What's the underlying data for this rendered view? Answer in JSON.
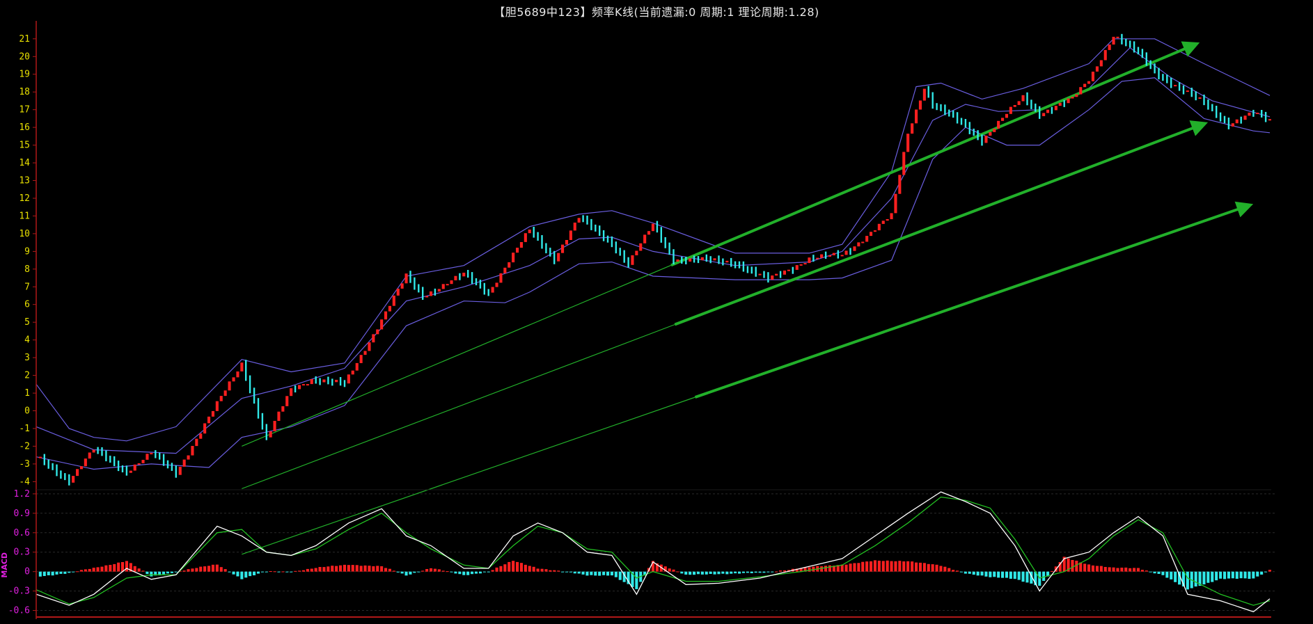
{
  "title": "【胆5689中123】频率K线(当前遗漏:0 周期:1 理论周期:1.28)",
  "colors": {
    "background": "#000000",
    "up_candle": "#ff2020",
    "down_candle": "#30e8e8",
    "band": "#6a5ee0",
    "trend": "#22b02a",
    "axis": "#b01818",
    "price_ticks": "#e8e000",
    "macd_ticks": "#e020e0",
    "dif": "#ffffff",
    "dea": "#22c022"
  },
  "chart_data": [
    {
      "type": "candlestick",
      "name": "price-panel",
      "ylim": [
        -4.3,
        21.7
      ],
      "yticks": [
        -4,
        -3,
        -2,
        -1,
        0,
        1,
        2,
        3,
        4,
        5,
        6,
        7,
        8,
        9,
        10,
        11,
        12,
        13,
        14,
        15,
        16,
        17,
        18,
        19,
        20,
        21
      ],
      "ytick_labels": [
        "-4",
        "-3",
        "-2",
        "-1",
        "0",
        "1",
        "2",
        "3",
        "4",
        "5",
        "6",
        "7",
        "8",
        "9",
        "10",
        "11",
        "12",
        "13",
        "14",
        "15",
        "16",
        "17",
        "18",
        "19",
        "20",
        "21"
      ],
      "count": 240,
      "path": [
        [
          0,
          -2.6
        ],
        [
          8,
          -3.9
        ],
        [
          14,
          -2.2
        ],
        [
          22,
          -3.4
        ],
        [
          28,
          -2.4
        ],
        [
          34,
          -3.5
        ],
        [
          50,
          2.7
        ],
        [
          56,
          -1.6
        ],
        [
          62,
          1.2
        ],
        [
          67,
          1.8
        ],
        [
          75,
          1.5
        ],
        [
          90,
          7.6
        ],
        [
          94,
          6.5
        ],
        [
          104,
          7.7
        ],
        [
          110,
          6.7
        ],
        [
          120,
          10.2
        ],
        [
          126,
          8.6
        ],
        [
          132,
          10.9
        ],
        [
          140,
          9.5
        ],
        [
          144,
          8.3
        ],
        [
          150,
          10.5
        ],
        [
          155,
          8.6
        ],
        [
          170,
          8.4
        ],
        [
          178,
          7.4
        ],
        [
          188,
          8.6
        ],
        [
          196,
          8.8
        ],
        [
          208,
          11.0
        ],
        [
          212,
          15.7
        ],
        [
          216,
          18.3
        ],
        [
          218,
          17.3
        ],
        [
          226,
          16.1
        ],
        [
          230,
          15.3
        ],
        [
          240,
          17.7
        ],
        [
          244,
          16.8
        ],
        [
          252,
          17.6
        ],
        [
          256,
          18.7
        ],
        [
          262,
          21.2
        ],
        [
          268,
          20.2
        ],
        [
          272,
          19.2
        ],
        [
          278,
          18.2
        ],
        [
          284,
          17.4
        ],
        [
          290,
          16.2
        ],
        [
          296,
          16.8
        ],
        [
          300,
          16.4
        ]
      ],
      "bands": {
        "upper": [
          [
            0,
            1.5
          ],
          [
            8,
            -1.0
          ],
          [
            14,
            -1.5
          ],
          [
            22,
            -1.7
          ],
          [
            34,
            -0.9
          ],
          [
            50,
            2.9
          ],
          [
            62,
            2.2
          ],
          [
            75,
            2.7
          ],
          [
            90,
            7.6
          ],
          [
            104,
            8.2
          ],
          [
            120,
            10.4
          ],
          [
            132,
            11.1
          ],
          [
            140,
            11.3
          ],
          [
            150,
            10.6
          ],
          [
            170,
            8.9
          ],
          [
            188,
            8.9
          ],
          [
            196,
            9.4
          ],
          [
            208,
            13.5
          ],
          [
            214,
            18.3
          ],
          [
            220,
            18.5
          ],
          [
            230,
            17.6
          ],
          [
            240,
            18.2
          ],
          [
            256,
            19.6
          ],
          [
            262,
            21.0
          ],
          [
            272,
            21.0
          ],
          [
            284,
            19.6
          ],
          [
            300,
            17.8
          ]
        ],
        "middle": [
          [
            0,
            -0.9
          ],
          [
            14,
            -2.2
          ],
          [
            34,
            -2.4
          ],
          [
            50,
            0.7
          ],
          [
            62,
            1.4
          ],
          [
            75,
            2.4
          ],
          [
            90,
            6.2
          ],
          [
            104,
            7.0
          ],
          [
            120,
            8.2
          ],
          [
            132,
            9.7
          ],
          [
            140,
            9.8
          ],
          [
            150,
            9.0
          ],
          [
            170,
            8.2
          ],
          [
            188,
            8.4
          ],
          [
            196,
            9.0
          ],
          [
            208,
            12.0
          ],
          [
            218,
            16.4
          ],
          [
            226,
            17.3
          ],
          [
            234,
            16.9
          ],
          [
            244,
            17.0
          ],
          [
            256,
            18.2
          ],
          [
            266,
            20.5
          ],
          [
            276,
            18.8
          ],
          [
            286,
            17.5
          ],
          [
            300,
            16.6
          ]
        ],
        "lower": [
          [
            0,
            -2.6
          ],
          [
            14,
            -3.3
          ],
          [
            28,
            -3.0
          ],
          [
            42,
            -3.2
          ],
          [
            50,
            -1.5
          ],
          [
            62,
            -0.9
          ],
          [
            75,
            0.3
          ],
          [
            90,
            4.8
          ],
          [
            104,
            6.2
          ],
          [
            114,
            6.1
          ],
          [
            120,
            6.7
          ],
          [
            132,
            8.3
          ],
          [
            140,
            8.4
          ],
          [
            150,
            7.6
          ],
          [
            170,
            7.4
          ],
          [
            188,
            7.4
          ],
          [
            196,
            7.5
          ],
          [
            208,
            8.5
          ],
          [
            218,
            14.2
          ],
          [
            226,
            16.0
          ],
          [
            236,
            15.0
          ],
          [
            244,
            15.0
          ],
          [
            256,
            17.0
          ],
          [
            264,
            18.6
          ],
          [
            272,
            18.8
          ],
          [
            284,
            16.5
          ],
          [
            296,
            15.8
          ],
          [
            300,
            15.7
          ]
        ]
      },
      "trend_lines": [
        {
          "from": [
            50,
            -2.0
          ],
          "to": [
            282,
            20.7
          ],
          "arrow": true
        },
        {
          "from": [
            50,
            -4.4
          ],
          "to": [
            284,
            16.2
          ],
          "arrow": true
        },
        {
          "from": [
            50,
            -8.1
          ],
          "to": [
            295,
            11.6
          ],
          "arrow": true
        }
      ]
    },
    {
      "type": "macd",
      "name": "macd-panel",
      "label": "MACD",
      "ylim": [
        -0.68,
        1.22
      ],
      "yticks": [
        1.2,
        0.9,
        0.6,
        0.3,
        0,
        -0.3,
        -0.6
      ],
      "ytick_labels": [
        "1.2",
        "0.9",
        "0.6",
        "0.3",
        "0",
        "-0.3",
        "-0.6"
      ],
      "dif": [
        [
          0,
          -0.35
        ],
        [
          8,
          -0.52
        ],
        [
          14,
          -0.35
        ],
        [
          22,
          0.05
        ],
        [
          28,
          -0.12
        ],
        [
          34,
          -0.05
        ],
        [
          44,
          0.7
        ],
        [
          50,
          0.55
        ],
        [
          56,
          0.3
        ],
        [
          62,
          0.25
        ],
        [
          68,
          0.4
        ],
        [
          76,
          0.75
        ],
        [
          84,
          0.97
        ],
        [
          90,
          0.55
        ],
        [
          96,
          0.4
        ],
        [
          104,
          0.05
        ],
        [
          110,
          0.05
        ],
        [
          116,
          0.55
        ],
        [
          122,
          0.75
        ],
        [
          128,
          0.6
        ],
        [
          134,
          0.3
        ],
        [
          140,
          0.25
        ],
        [
          146,
          -0.35
        ],
        [
          150,
          0.15
        ],
        [
          158,
          -0.2
        ],
        [
          166,
          -0.18
        ],
        [
          176,
          -0.1
        ],
        [
          186,
          0.05
        ],
        [
          196,
          0.2
        ],
        [
          204,
          0.55
        ],
        [
          212,
          0.9
        ],
        [
          220,
          1.23
        ],
        [
          226,
          1.08
        ],
        [
          232,
          0.9
        ],
        [
          238,
          0.4
        ],
        [
          244,
          -0.3
        ],
        [
          250,
          0.2
        ],
        [
          256,
          0.3
        ],
        [
          262,
          0.6
        ],
        [
          268,
          0.85
        ],
        [
          274,
          0.55
        ],
        [
          280,
          -0.35
        ],
        [
          288,
          -0.45
        ],
        [
          296,
          -0.62
        ],
        [
          300,
          -0.42
        ]
      ],
      "dea": [
        [
          0,
          -0.28
        ],
        [
          8,
          -0.5
        ],
        [
          14,
          -0.4
        ],
        [
          22,
          -0.1
        ],
        [
          28,
          -0.05
        ],
        [
          34,
          -0.05
        ],
        [
          44,
          0.6
        ],
        [
          50,
          0.65
        ],
        [
          56,
          0.3
        ],
        [
          62,
          0.25
        ],
        [
          68,
          0.35
        ],
        [
          76,
          0.65
        ],
        [
          84,
          0.9
        ],
        [
          90,
          0.6
        ],
        [
          96,
          0.35
        ],
        [
          104,
          0.1
        ],
        [
          110,
          0.05
        ],
        [
          116,
          0.4
        ],
        [
          122,
          0.7
        ],
        [
          128,
          0.6
        ],
        [
          134,
          0.35
        ],
        [
          140,
          0.3
        ],
        [
          146,
          -0.1
        ],
        [
          150,
          0.0
        ],
        [
          158,
          -0.15
        ],
        [
          166,
          -0.15
        ],
        [
          176,
          -0.08
        ],
        [
          186,
          0.0
        ],
        [
          196,
          0.1
        ],
        [
          204,
          0.4
        ],
        [
          212,
          0.75
        ],
        [
          220,
          1.15
        ],
        [
          226,
          1.1
        ],
        [
          232,
          0.98
        ],
        [
          238,
          0.5
        ],
        [
          244,
          -0.1
        ],
        [
          250,
          0.0
        ],
        [
          256,
          0.2
        ],
        [
          262,
          0.55
        ],
        [
          268,
          0.8
        ],
        [
          274,
          0.6
        ],
        [
          280,
          -0.1
        ],
        [
          288,
          -0.35
        ],
        [
          296,
          -0.52
        ],
        [
          300,
          -0.45
        ]
      ]
    }
  ]
}
